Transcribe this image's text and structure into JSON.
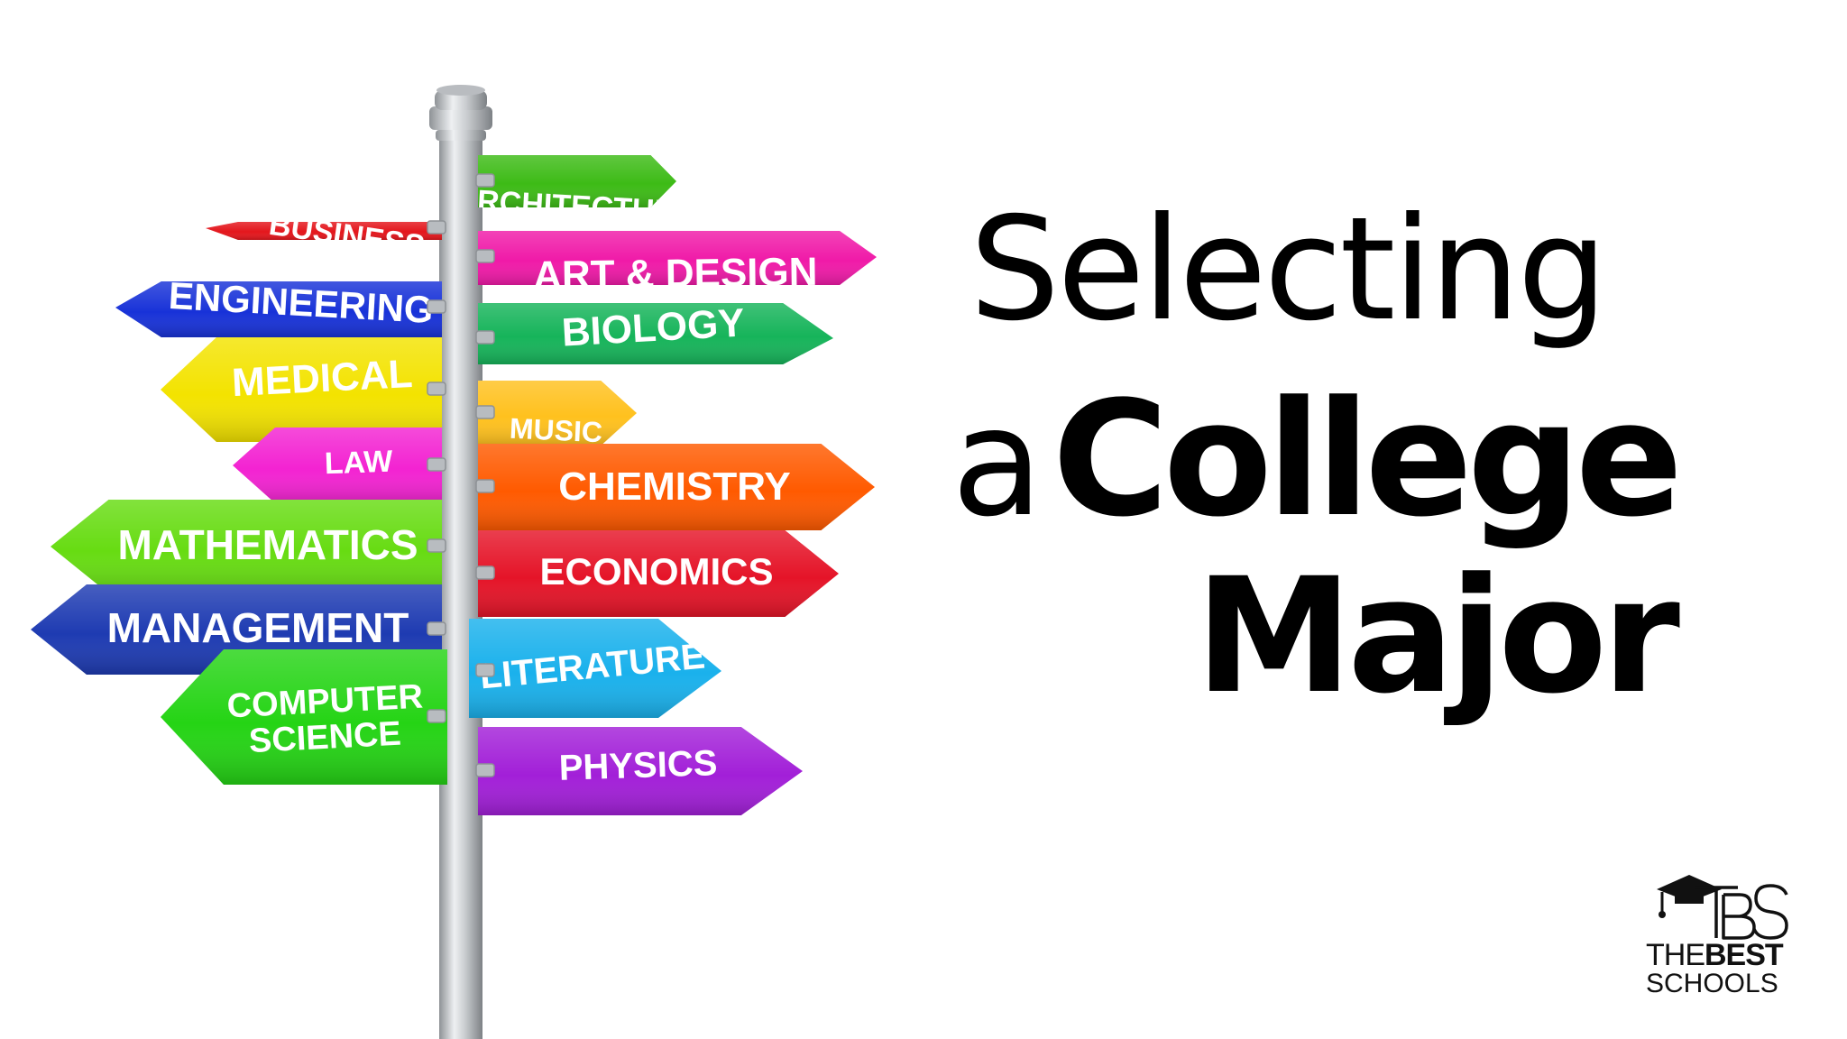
{
  "headline": {
    "line1": "Selecting",
    "line2_small": "a",
    "line2_bold": "College",
    "line3": "Major"
  },
  "signs": [
    {
      "key": "architecture",
      "label": "ARCHITECTURE",
      "color": "#3dbb16"
    },
    {
      "key": "business",
      "label": "BUSINESS",
      "color": "#e4161c"
    },
    {
      "key": "art_design",
      "label": "ART & DESIGN",
      "color": "#f01aa8"
    },
    {
      "key": "engineering",
      "label": "ENGINEERING",
      "color": "#1832d8"
    },
    {
      "key": "biology",
      "label": "BIOLOGY",
      "color": "#16b45a"
    },
    {
      "key": "medical",
      "label": "MEDICAL",
      "color": "#f3e300"
    },
    {
      "key": "music",
      "label": "MUSIC",
      "color": "#ffc11e"
    },
    {
      "key": "law",
      "label": "LAW",
      "color": "#f323d2"
    },
    {
      "key": "chemistry",
      "label": "CHEMISTRY",
      "color": "#ff5a00"
    },
    {
      "key": "mathematics",
      "label": "MATHEMATICS",
      "color": "#67dc12"
    },
    {
      "key": "economics",
      "label": "ECONOMICS",
      "color": "#e51428"
    },
    {
      "key": "management",
      "label": "MANAGEMENT",
      "color": "#1e3bb2"
    },
    {
      "key": "literature",
      "label": "LITERATURE",
      "color": "#1ab1ec"
    },
    {
      "key": "computer_science",
      "label": [
        "COMPUTER",
        "SCIENCE"
      ],
      "color": "#25d415"
    },
    {
      "key": "physics",
      "label": "PHYSICS",
      "color": "#a21fd8"
    }
  ],
  "logo": {
    "mark": "TBS",
    "line1_thin": "THE",
    "line1_bold": "BEST",
    "line2": "SCHOOLS",
    "icon": "graduation-cap-icon"
  },
  "colors": {
    "pole": "#c9cccf",
    "text": "#000000",
    "background": "#ffffff"
  }
}
